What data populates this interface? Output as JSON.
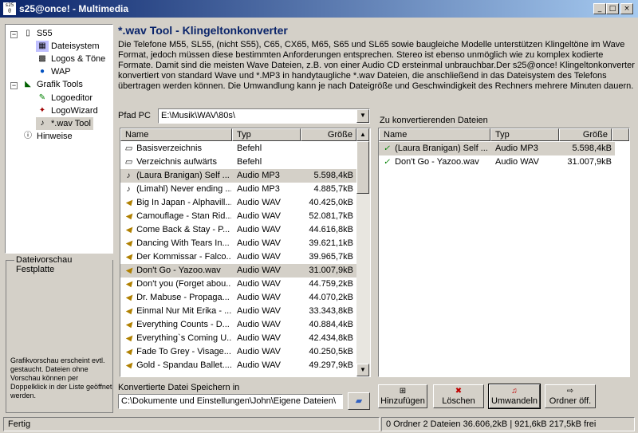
{
  "window": {
    "title": "s25@once! - Multimedia",
    "controls": [
      "_",
      "□",
      "×"
    ]
  },
  "tree": {
    "items": [
      {
        "label": "S55",
        "icon": "phone-icon"
      },
      {
        "label": "Dateisystem",
        "icon": "filesystem-icon"
      },
      {
        "label": "Logos & Töne",
        "icon": "logos-icon"
      },
      {
        "label": "WAP",
        "icon": "wap-globe-icon"
      },
      {
        "label": "Grafik Tools",
        "icon": "graphic-tools-icon"
      },
      {
        "label": "Logoeditor",
        "icon": "logoeditor-icon"
      },
      {
        "label": "LogoWizard",
        "icon": "logowizard-icon"
      },
      {
        "label": "*.wav Tool",
        "icon": "wav-tool-icon"
      },
      {
        "label": "Hinweise",
        "icon": "info-icon"
      }
    ]
  },
  "preview": {
    "label": "Dateivorschau Festplatte",
    "text": "Grafikvorschau erscheint evtl. gestaucht. Dateien ohne Vorschau können per Doppelklick in der Liste geöffnet werden."
  },
  "main": {
    "heading": "*.wav Tool - Klingeltonkonverter",
    "description": "Die Telefone M55, SL55, (nicht S55), C65, CX65, M65, S65 und SL65 sowie baugleiche Modelle unterstützen Klingeltöne im Wave Format, jedoch müssen diese bestimmten Anforderungen entsprechen. Stereo ist ebenso unmöglich wie zu komplex kodierte Formate. Damit sind die meisten Wave Dateien, z.B. von einer Audio CD ersteinmal unbrauchbar.Der s25@once! Klingeltonkonverter konvertiert von standard Wave und *.MP3 in handytaugliche *.wav Dateien, die anschließend in das Dateisystem des Telefons übertragen werden können. Die Umwandlung kann je nach Dateigröße und Geschwindigkeit des Rechners mehrere Minuten dauern."
  },
  "path": {
    "label": "Pfad PC",
    "value": "E:\\Musik\\WAV\\80s\\"
  },
  "file_list": {
    "columns": [
      "Name",
      "Typ",
      "Größe"
    ],
    "rows": [
      {
        "name": "Basisverzeichnis",
        "type": "Befehl",
        "size": "",
        "icon": "folder-command-icon"
      },
      {
        "name": "Verzeichnis aufwärts",
        "type": "Befehl",
        "size": "",
        "icon": "folder-up-icon"
      },
      {
        "name": "(Laura Branigan) Self ...",
        "type": "Audio MP3",
        "size": "5.598,4kB",
        "icon": "mp3-icon"
      },
      {
        "name": "(Limahl) Never ending ...",
        "type": "Audio MP3",
        "size": "4.885,7kB",
        "icon": "mp3-icon"
      },
      {
        "name": "Big In Japan - Alphavill...",
        "type": "Audio WAV",
        "size": "40.425,0kB",
        "icon": "speaker-icon"
      },
      {
        "name": "Camouflage - Stan Rid...",
        "type": "Audio WAV",
        "size": "52.081,7kB",
        "icon": "speaker-icon"
      },
      {
        "name": "Come Back & Stay - P...",
        "type": "Audio WAV",
        "size": "44.616,8kB",
        "icon": "speaker-icon"
      },
      {
        "name": "Dancing With Tears In...",
        "type": "Audio WAV",
        "size": "39.621,1kB",
        "icon": "speaker-icon"
      },
      {
        "name": "Der Kommissar - Falco...",
        "type": "Audio WAV",
        "size": "39.965,7kB",
        "icon": "speaker-icon"
      },
      {
        "name": "Don't Go - Yazoo.wav",
        "type": "Audio WAV",
        "size": "31.007,9kB",
        "icon": "speaker-icon"
      },
      {
        "name": "Don't you (Forget abou...",
        "type": "Audio WAV",
        "size": "44.759,2kB",
        "icon": "speaker-icon"
      },
      {
        "name": "Dr. Mabuse - Propaga...",
        "type": "Audio WAV",
        "size": "44.070,2kB",
        "icon": "speaker-icon"
      },
      {
        "name": "Einmal Nur Mit Erika - ...",
        "type": "Audio WAV",
        "size": "33.343,8kB",
        "icon": "speaker-icon"
      },
      {
        "name": "Everything Counts - D...",
        "type": "Audio WAV",
        "size": "40.884,4kB",
        "icon": "speaker-icon"
      },
      {
        "name": "Everything`s Coming U...",
        "type": "Audio WAV",
        "size": "42.434,8kB",
        "icon": "speaker-icon"
      },
      {
        "name": "Fade To Grey - Visage...",
        "type": "Audio WAV",
        "size": "40.250,5kB",
        "icon": "speaker-icon"
      },
      {
        "name": "Gold - Spandau Ballet....",
        "type": "Audio WAV",
        "size": "49.297,9kB",
        "icon": "speaker-icon"
      }
    ]
  },
  "convert_list": {
    "label": "Zu konvertierenden Dateien",
    "columns": [
      "Name",
      "Typ",
      "Größe"
    ],
    "rows": [
      {
        "name": "(Laura Branigan) Self ...",
        "type": "Audio MP3",
        "size": "5.598,4kB",
        "icon": "note-check-icon"
      },
      {
        "name": "Don't Go - Yazoo.wav",
        "type": "Audio WAV",
        "size": "31.007,9kB",
        "icon": "note-check-icon"
      }
    ]
  },
  "save": {
    "label": "Konvertierte Datei Speichern in",
    "value": "C:\\Dokumente und Einstellungen\\John\\Eigene Dateien\\"
  },
  "buttons": {
    "add": "Hinzufügen",
    "delete": "Löschen",
    "convert": "Umwandeln",
    "open_folder": "Ordner öff."
  },
  "status": {
    "left": "Fertig",
    "right": "0 Ordner 2 Dateien 36.606,2kB | 921,6kB 217,5kB frei"
  },
  "colors": {
    "titlebar_start": "#0a246a",
    "titlebar_end": "#a6caf0",
    "heading": "#0a246a",
    "face": "#d4d0c8"
  }
}
